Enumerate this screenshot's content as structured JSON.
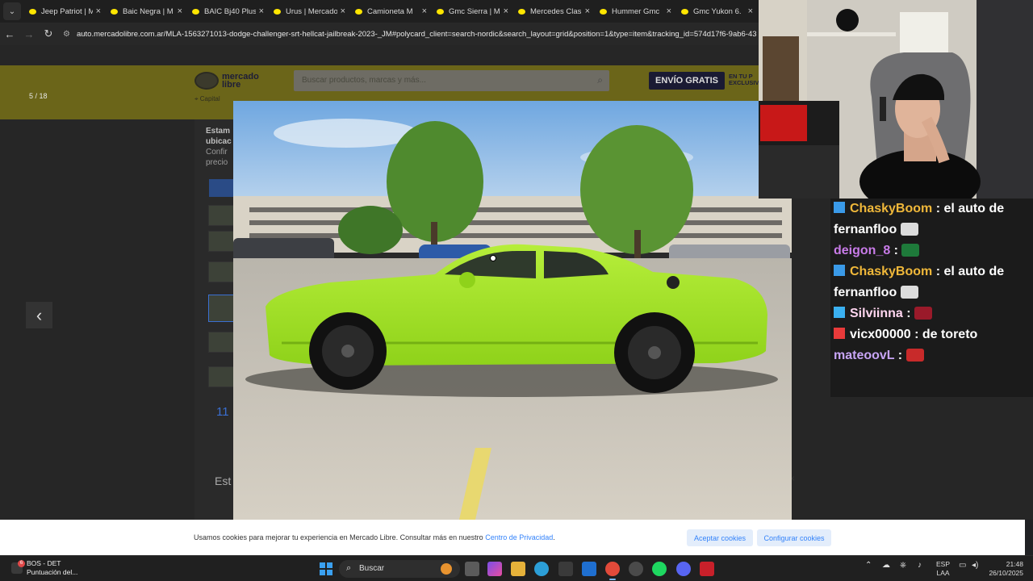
{
  "browser": {
    "tabs": [
      {
        "title": "Jeep Patriot | M"
      },
      {
        "title": "Baic Negra | M"
      },
      {
        "title": "BAIC Bj40 Plus"
      },
      {
        "title": "Urus | Mercado"
      },
      {
        "title": "Camioneta M"
      },
      {
        "title": "Gmc Sierra | M"
      },
      {
        "title": "Mercedes Clas"
      },
      {
        "title": "Hummer Gmc"
      },
      {
        "title": "Gmc Yukon 6."
      }
    ],
    "url": "auto.mercadolibre.com.ar/MLA-1563271013-dodge-challenger-srt-hellcat-jailbreak-2023-_JM#polycard_client=search-nordic&search_layout=grid&position=1&type=item&tracking_id=574d17f6-9ab6-43"
  },
  "page": {
    "counter": "5 / 18",
    "logo_line1": "mercado",
    "logo_line2": "libre",
    "search_placeholder": "Buscar productos, marcas y más...",
    "envio_label": "ENVÍO GRATIS",
    "envio_sub1": "EN TU P",
    "envio_sub2": "EXCLUSIV",
    "location": "Capital",
    "notice_title1": "Estam",
    "notice_title2": "ubicac",
    "notice_body1": "Confir",
    "notice_body2": "precio",
    "confirm_label": "Conf",
    "more_thumbs": "11",
    "es_text": "Est"
  },
  "cookie": {
    "message": "Usamos cookies para mejorar tu experiencia en Mercado Libre. Consultar más en nuestro",
    "link": "Centro de Privacidad",
    "link_suffix": ".",
    "accept": "Aceptar cookies",
    "configure": "Configurar cookies"
  },
  "chat": [
    {
      "user": "ChaskyBoom",
      "color": "#f0b83a",
      "badge": "#3a9ae8",
      "text": "el auto de fernanfloo",
      "emote": "#dcdcdc"
    },
    {
      "user": "deigon_8",
      "color": "#c87be8",
      "badge": "",
      "text": "",
      "emote": "#1e7a3a"
    },
    {
      "user": "ChaskyBoom",
      "color": "#f0b83a",
      "badge": "#3a9ae8",
      "text": "el auto de fernanfloo",
      "emote": "#dcdcdc"
    },
    {
      "user": "Silviinna",
      "color": "#ffd6f0",
      "badge": "#3ab0f0",
      "text": "",
      "emote": "#9a1a2a"
    },
    {
      "user": "vicx00000",
      "color": "#ffffff",
      "badge": "#e83a3a",
      "text": "de toreto",
      "emote": ""
    },
    {
      "user": "mateoovL",
      "color": "#c7a4f5",
      "badge": "",
      "text": "",
      "emote": "#c82a2a"
    }
  ],
  "taskbar": {
    "weather_line1": "BOS - DET",
    "weather_line2": "Puntuación del...",
    "weather_badge": "6",
    "search_label": "Buscar",
    "lang1": "ESP",
    "lang2": "LAA",
    "time": "21:48",
    "date": "26/10/2025"
  }
}
